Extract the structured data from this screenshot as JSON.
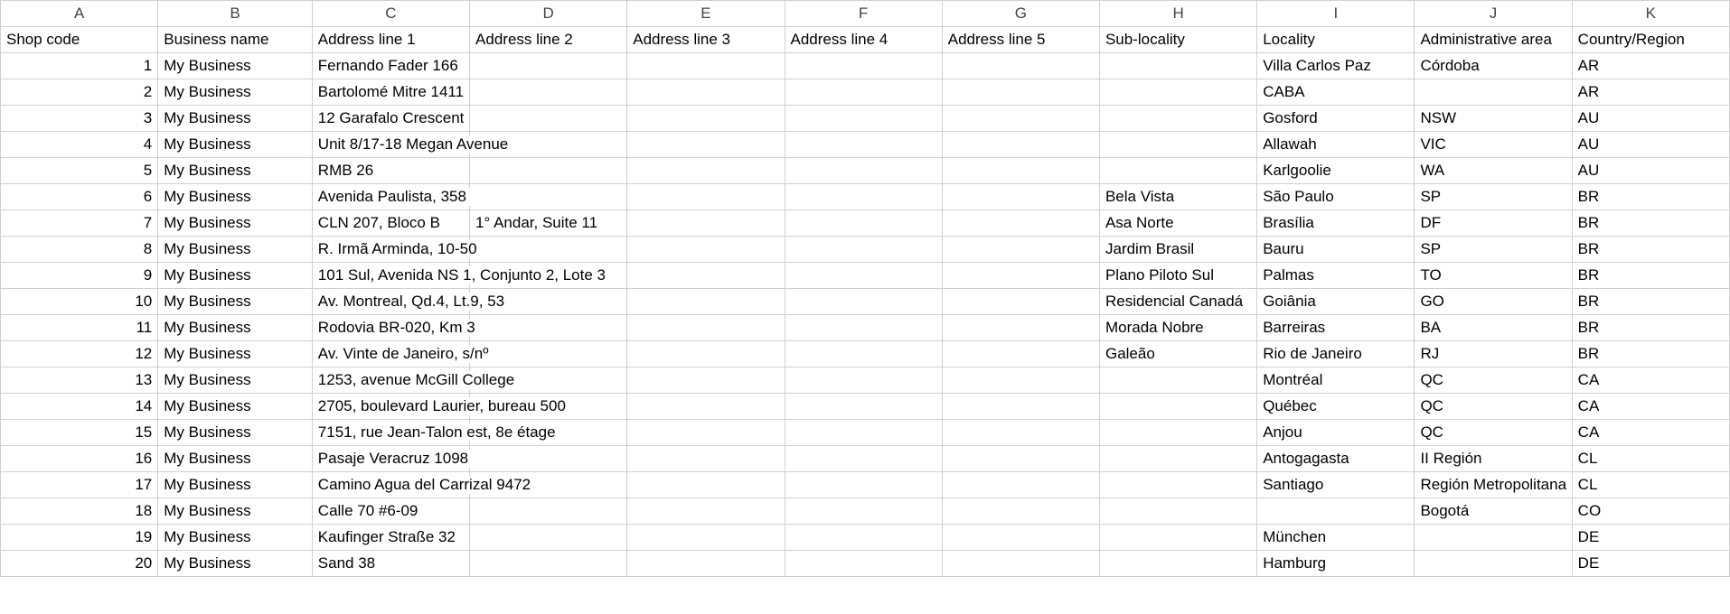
{
  "columns": [
    "A",
    "B",
    "C",
    "D",
    "E",
    "F",
    "G",
    "H",
    "I",
    "J",
    "K"
  ],
  "headerRow": [
    "Shop code",
    "Business name",
    "Address line 1",
    "Address line 2",
    "Address line 3",
    "Address line 4",
    "Address line 5",
    "Sub-locality",
    "Locality",
    "Administrative area",
    "Country/Region"
  ],
  "rows": [
    {
      "code": "1",
      "biz": "My Business",
      "addr1": "Fernando Fader 166",
      "addr2": "",
      "addr3": "",
      "addr4": "",
      "addr5": "",
      "sub": "",
      "loc": "Villa Carlos Paz",
      "admin": "Córdoba",
      "country": "AR"
    },
    {
      "code": "2",
      "biz": "My Business",
      "addr1": "Bartolomé Mitre 1411",
      "addr2": "",
      "addr3": "",
      "addr4": "",
      "addr5": "",
      "sub": "",
      "loc": "CABA",
      "admin": "",
      "country": "AR"
    },
    {
      "code": "3",
      "biz": "My Business",
      "addr1": "12 Garafalo Crescent",
      "addr2": "",
      "addr3": "",
      "addr4": "",
      "addr5": "",
      "sub": "",
      "loc": "Gosford",
      "admin": "NSW",
      "country": "AU"
    },
    {
      "code": "4",
      "biz": "My Business",
      "addr1": "Unit 8/17-18 Megan Avenue",
      "addr2": "",
      "addr3": "",
      "addr4": "",
      "addr5": "",
      "sub": "",
      "loc": "Allawah",
      "admin": "VIC",
      "country": "AU"
    },
    {
      "code": "5",
      "biz": "My Business",
      "addr1": "RMB 26",
      "addr2": "",
      "addr3": "",
      "addr4": "",
      "addr5": "",
      "sub": "",
      "loc": "Karlgoolie",
      "admin": "WA",
      "country": "AU"
    },
    {
      "code": "6",
      "biz": "My Business",
      "addr1": "Avenida Paulista, 358",
      "addr2": "",
      "addr3": "",
      "addr4": "",
      "addr5": "",
      "sub": "Bela Vista",
      "loc": "São Paulo",
      "admin": "SP",
      "country": "BR"
    },
    {
      "code": "7",
      "biz": "My Business",
      "addr1": "CLN 207, Bloco B",
      "addr2": "1° Andar, Suite 11",
      "addr3": "",
      "addr4": "",
      "addr5": "",
      "sub": "Asa Norte",
      "loc": "Brasília",
      "admin": "DF",
      "country": "BR"
    },
    {
      "code": "8",
      "biz": "My Business",
      "addr1": "R. Irmã Arminda, 10-50",
      "addr2": "",
      "addr3": "",
      "addr4": "",
      "addr5": "",
      "sub": "Jardim Brasil",
      "loc": "Bauru",
      "admin": "SP",
      "country": "BR"
    },
    {
      "code": "9",
      "biz": "My Business",
      "addr1": "101 Sul, Avenida NS 1, Conjunto 2, Lote 3",
      "addr2": "",
      "addr3": "",
      "addr4": "",
      "addr5": "",
      "sub": "Plano Piloto Sul",
      "loc": "Palmas",
      "admin": "TO",
      "country": "BR"
    },
    {
      "code": "10",
      "biz": "My Business",
      "addr1": "Av. Montreal, Qd.4, Lt.9, 53",
      "addr2": "",
      "addr3": "",
      "addr4": "",
      "addr5": "",
      "sub": "Residencial Canadá",
      "loc": "Goiânia",
      "admin": "GO",
      "country": "BR"
    },
    {
      "code": "11",
      "biz": "My Business",
      "addr1": "Rodovia BR-020, Km 3",
      "addr2": "",
      "addr3": "",
      "addr4": "",
      "addr5": "",
      "sub": "Morada Nobre",
      "loc": "Barreiras",
      "admin": "BA",
      "country": "BR"
    },
    {
      "code": "12",
      "biz": "My Business",
      "addr1": "Av. Vinte de Janeiro, s/nº",
      "addr2": "",
      "addr3": "",
      "addr4": "",
      "addr5": "",
      "sub": "Galeão",
      "loc": "Rio de Janeiro",
      "admin": "RJ",
      "country": "BR"
    },
    {
      "code": "13",
      "biz": "My Business",
      "addr1": "1253, avenue McGill College",
      "addr2": "",
      "addr3": "",
      "addr4": "",
      "addr5": "",
      "sub": "",
      "loc": "Montréal",
      "admin": "QC",
      "country": "CA"
    },
    {
      "code": "14",
      "biz": "My Business",
      "addr1": "2705, boulevard Laurier, bureau 500",
      "addr2": "",
      "addr3": "",
      "addr4": "",
      "addr5": "",
      "sub": "",
      "loc": "Québec",
      "admin": "QC",
      "country": "CA"
    },
    {
      "code": "15",
      "biz": "My Business",
      "addr1": "7151, rue Jean-Talon est, 8e étage",
      "addr2": "",
      "addr3": "",
      "addr4": "",
      "addr5": "",
      "sub": "",
      "loc": "Anjou",
      "admin": "QC",
      "country": "CA"
    },
    {
      "code": "16",
      "biz": "My Business",
      "addr1": "Pasaje Veracruz 1098",
      "addr2": "",
      "addr3": "",
      "addr4": "",
      "addr5": "",
      "sub": "",
      "loc": "Antogagasta",
      "admin": "II Región",
      "country": "CL"
    },
    {
      "code": "17",
      "biz": "My Business",
      "addr1": "Camino Agua del Carrizal 9472",
      "addr2": "",
      "addr3": "",
      "addr4": "",
      "addr5": "",
      "sub": "",
      "loc": "Santiago",
      "admin": "Región Metropolitana",
      "country": "CL"
    },
    {
      "code": "18",
      "biz": "My Business",
      "addr1": "Calle 70 #6-09",
      "addr2": "",
      "addr3": "",
      "addr4": "",
      "addr5": "",
      "sub": "",
      "loc": "",
      "admin": "Bogotá",
      "country": "CO"
    },
    {
      "code": "19",
      "biz": "My Business",
      "addr1": "Kaufinger Straße 32",
      "addr2": "",
      "addr3": "",
      "addr4": "",
      "addr5": "",
      "sub": "",
      "loc": "München",
      "admin": "",
      "country": "DE"
    },
    {
      "code": "20",
      "biz": "My Business",
      "addr1": "Sand 38",
      "addr2": "",
      "addr3": "",
      "addr4": "",
      "addr5": "",
      "sub": "",
      "loc": "Hamburg",
      "admin": "",
      "country": "DE"
    }
  ]
}
